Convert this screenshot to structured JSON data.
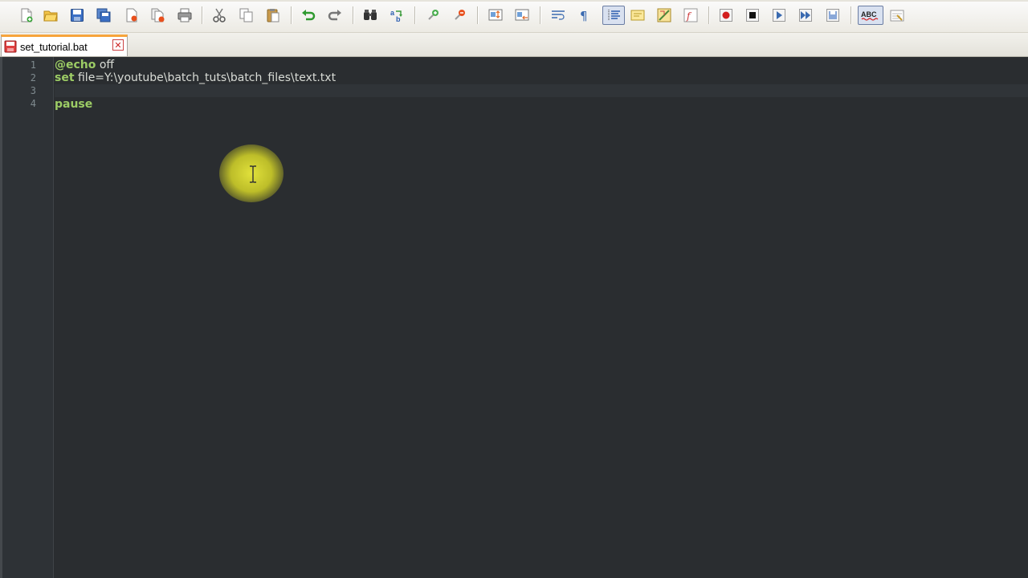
{
  "toolbar": {
    "buttons": [
      {
        "name": "new-file-icon"
      },
      {
        "name": "open-file-icon"
      },
      {
        "name": "save-icon"
      },
      {
        "name": "save-all-icon"
      },
      {
        "name": "close-icon"
      },
      {
        "name": "close-all-icon"
      },
      {
        "name": "print-icon"
      },
      {
        "name": "cut-icon"
      },
      {
        "name": "copy-icon"
      },
      {
        "name": "paste-icon"
      },
      {
        "name": "undo-icon"
      },
      {
        "name": "redo-icon"
      },
      {
        "name": "find-icon"
      },
      {
        "name": "replace-icon"
      },
      {
        "name": "zoom-in-icon"
      },
      {
        "name": "zoom-out-icon"
      },
      {
        "name": "sync-vertical-icon"
      },
      {
        "name": "sync-horizontal-icon"
      },
      {
        "name": "word-wrap-icon"
      },
      {
        "name": "show-all-characters-icon"
      },
      {
        "name": "indent-guide-icon"
      },
      {
        "name": "user-defined-language-icon"
      },
      {
        "name": "doc-map-icon"
      },
      {
        "name": "function-list-icon"
      },
      {
        "name": "record-macro-icon"
      },
      {
        "name": "stop-recording-icon"
      },
      {
        "name": "playback-macro-icon"
      },
      {
        "name": "run-macro-multiple-icon"
      },
      {
        "name": "save-macro-icon"
      },
      {
        "name": "spell-check-icon",
        "label": "ABC"
      },
      {
        "name": "spell-settings-icon"
      }
    ],
    "spell_label": "ABC"
  },
  "tabs": [
    {
      "label": "set_tutorial.bat",
      "active": true,
      "close_glyph": "✕"
    }
  ],
  "editor": {
    "line_numbers": [
      "1",
      "2",
      "3",
      "4"
    ],
    "lines": [
      {
        "keyword": "@echo",
        "rest": " off"
      },
      {
        "keyword": "set",
        "rest": " file=Y:\\youtube\\batch_tuts\\batch_files\\text.txt"
      },
      {
        "keyword": "",
        "rest": ""
      },
      {
        "keyword": "pause",
        "rest": ""
      }
    ],
    "colors": {
      "background": "#2a2d30",
      "keyword": "#9ccc65",
      "text": "#d9dcd6",
      "line_number": "#7f8a8f"
    }
  },
  "accent_colors": {
    "active_tab_top": "#f7a43b",
    "cursor_highlight": "#e6e63a"
  }
}
